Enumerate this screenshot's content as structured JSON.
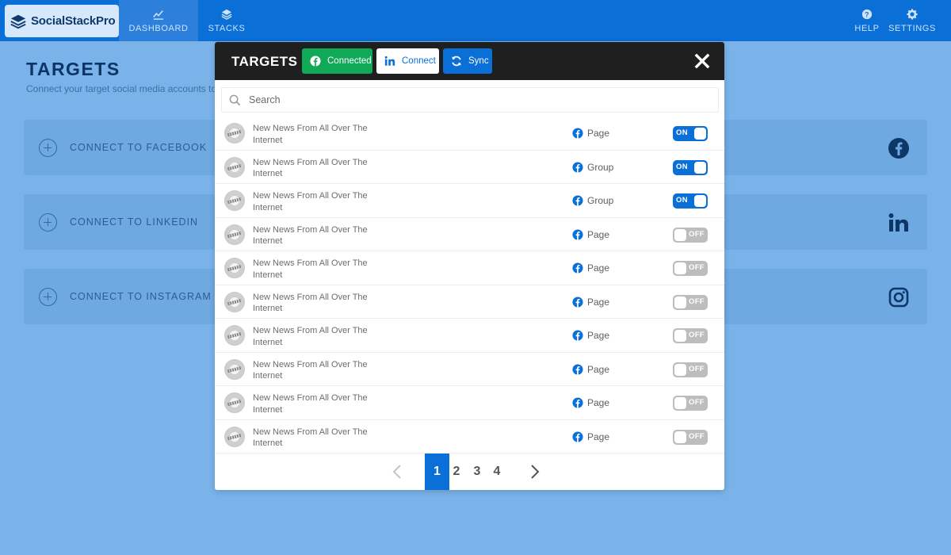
{
  "app": {
    "brand": "SocialStackPro",
    "nav": [
      {
        "id": "dashboard",
        "label": "DASHBOARD",
        "icon": "line-chart-icon"
      },
      {
        "id": "stacks",
        "label": "STACKS",
        "icon": "layers-icon"
      },
      {
        "id": "help",
        "label": "HELP",
        "icon": "help-icon"
      },
      {
        "id": "settings",
        "label": "SETTINGS",
        "icon": "gear-icon"
      }
    ]
  },
  "page": {
    "title": "TARGETS",
    "subtitle": "Connect your target social media accounts to g",
    "cards": [
      {
        "label": "CONNECT TO FACEBOOK",
        "icon": "facebook-icon"
      },
      {
        "label": "CONNECT TO LINKEDIN",
        "icon": "linkedin-icon"
      },
      {
        "label": "CONNECT TO INSTAGRAM",
        "icon": "instagram-icon"
      }
    ]
  },
  "modal": {
    "title": "TARGETS",
    "buttons": {
      "connected": "Connected",
      "connect": "Connect",
      "sync": "Sync"
    },
    "search": {
      "placeholder": "Search",
      "value": ""
    },
    "rows": [
      {
        "line1": "New News From All Over The",
        "line2": "Internet",
        "type": "Page",
        "state": "ON"
      },
      {
        "line1": "New News From All Over The",
        "line2": "Internet",
        "type": "Group",
        "state": "ON"
      },
      {
        "line1": "New News From All Over The",
        "line2": "Internet",
        "type": "Group",
        "state": "ON"
      },
      {
        "line1": "New News From All Over The",
        "line2": "Internet",
        "type": "Page",
        "state": "OFF"
      },
      {
        "line1": "New News From All Over The",
        "line2": "Internet",
        "type": "Page",
        "state": "OFF"
      },
      {
        "line1": "New News From All Over The",
        "line2": "Internet",
        "type": "Page",
        "state": "OFF"
      },
      {
        "line1": "New News From All Over The",
        "line2": "Internet",
        "type": "Page",
        "state": "OFF"
      },
      {
        "line1": "New News From All Over The",
        "line2": "Internet",
        "type": "Page",
        "state": "OFF"
      },
      {
        "line1": "New News From All Over The",
        "line2": "Internet",
        "type": "Page",
        "state": "OFF"
      },
      {
        "line1": "New News From All Over The",
        "line2": "Internet",
        "type": "Page",
        "state": "OFF"
      }
    ],
    "pagination": {
      "pages": [
        "1",
        "2",
        "3",
        "4"
      ],
      "current": "1"
    }
  },
  "colors": {
    "primary": "#0b6fd8",
    "success": "#10a957",
    "header_dark": "#1f1f1f",
    "page_bg": "#7ab3e9",
    "toggle_off": "#bdbdbd"
  }
}
